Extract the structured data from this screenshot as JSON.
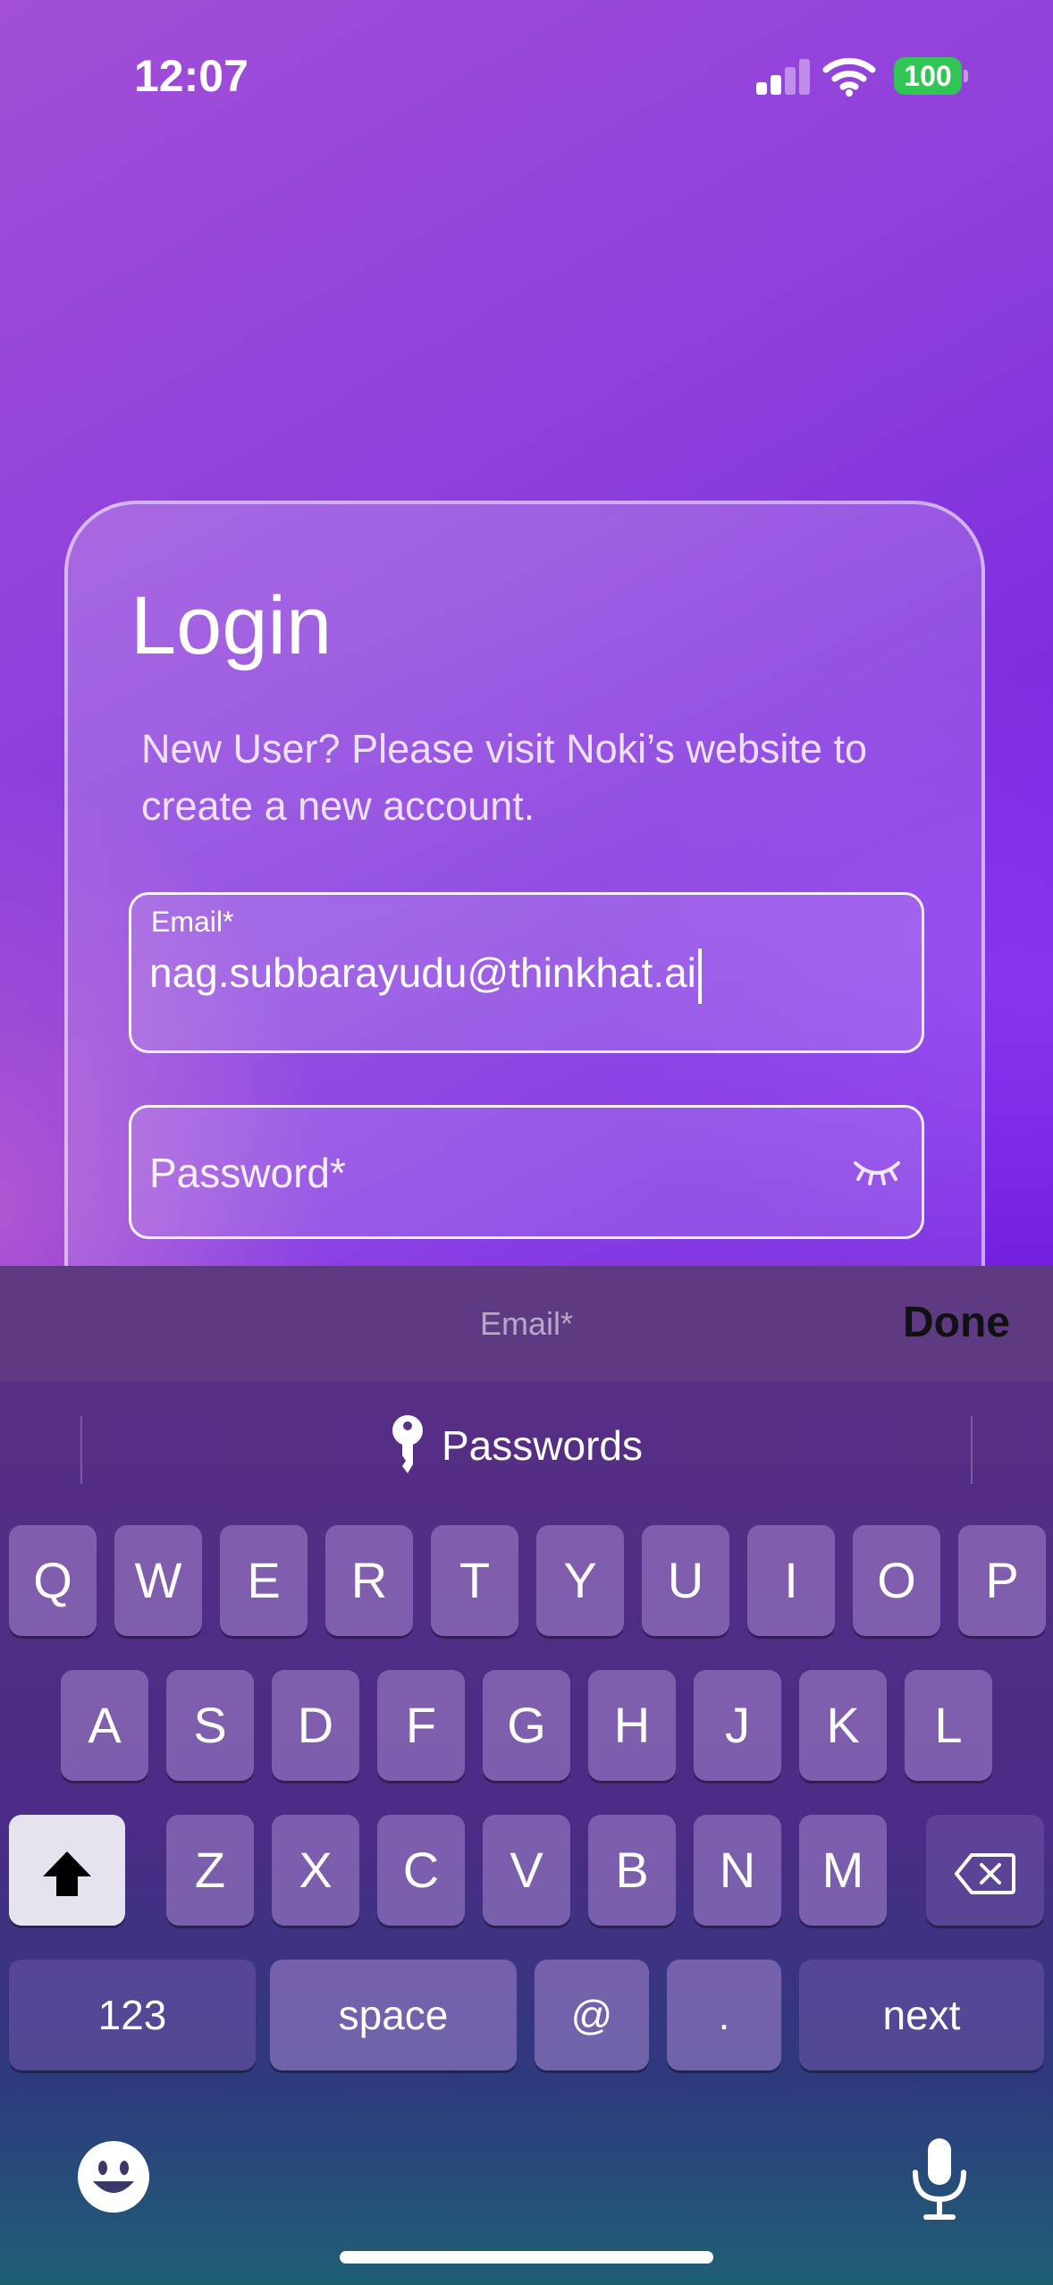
{
  "status_bar": {
    "time": "12:07",
    "battery": "100"
  },
  "login": {
    "title": "Login",
    "subtitle": "New User? Please visit Noki’s website to create a new account.",
    "email": {
      "label": "Email*",
      "value": "nag.subbarayudu@thinkhat.ai"
    },
    "password": {
      "placeholder": "Password*"
    }
  },
  "keyboard_toolbar": {
    "field_label": "Email*",
    "done": "Done"
  },
  "suggestions": {
    "passwords": "Passwords"
  },
  "keyboard": {
    "row1": [
      "Q",
      "W",
      "E",
      "R",
      "T",
      "Y",
      "U",
      "I",
      "O",
      "P"
    ],
    "row2": [
      "A",
      "S",
      "D",
      "F",
      "G",
      "H",
      "J",
      "K",
      "L"
    ],
    "row3": [
      "Z",
      "X",
      "C",
      "V",
      "B",
      "N",
      "M"
    ],
    "numbers": "123",
    "space": "space",
    "at": "@",
    "dot": ".",
    "next": "next"
  },
  "colors": {
    "accent_purple": "#7a2ae0",
    "battery_green": "#31c653"
  }
}
